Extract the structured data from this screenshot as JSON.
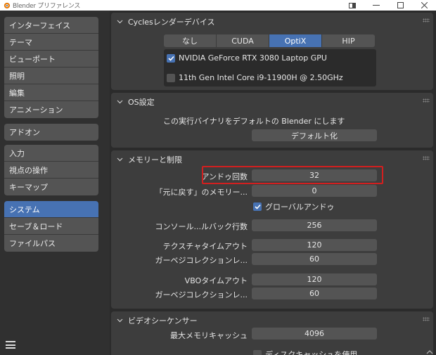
{
  "window": {
    "title": "Blender プリファレンス"
  },
  "sidebar": {
    "groups": [
      [
        "インターフェイス",
        "テーマ",
        "ビューポート",
        "照明",
        "編集",
        "アニメーション"
      ],
      [
        "アドオン"
      ],
      [
        "入力",
        "視点の操作",
        "キーマップ"
      ],
      [
        "システム",
        "セーブ＆ロード",
        "ファイルパス"
      ]
    ],
    "active": "システム"
  },
  "cycles": {
    "title": "Cyclesレンダーデバイス",
    "options": [
      "なし",
      "CUDA",
      "OptiX",
      "HIP"
    ],
    "selected": "OptiX",
    "devices": [
      {
        "name": "NVIDIA GeForce RTX 3080 Laptop GPU",
        "checked": true
      },
      {
        "name": "11th Gen Intel Core i9-11900H @ 2.50GHz",
        "checked": false
      }
    ]
  },
  "os": {
    "title": "OS設定",
    "description": "この実行バイナリをデフォルトの Blender にします",
    "button": "デフォルト化"
  },
  "memory": {
    "title": "メモリーと制限",
    "undo_steps_label": "アンドゥ回数",
    "undo_steps": "32",
    "undo_memory_label": "「元に戻す」のメモリー...",
    "undo_memory": "0",
    "global_undo_label": "グローバルアンドゥ",
    "global_undo": true,
    "console_label": "コンソール...ルバック行数",
    "console_value": "256",
    "tex_timeout_label": "テクスチャタイムアウト",
    "tex_timeout": "120",
    "gc_label_1": "ガーベジコレクションレ...",
    "gc_value_1": "60",
    "vbo_timeout_label": "VBOタイムアウト",
    "vbo_timeout": "120",
    "gc_label_2": "ガーベジコレクションレ...",
    "gc_value_2": "60"
  },
  "sequencer": {
    "title": "ビデオシーケンサー",
    "cache_label": "最大メモリキャッシュ",
    "cache_value": "4096",
    "disk_cache_label": "ディスクキャッシュを使用"
  },
  "colors": {
    "accent": "#4772b3",
    "highlight": "#d21f1f"
  }
}
